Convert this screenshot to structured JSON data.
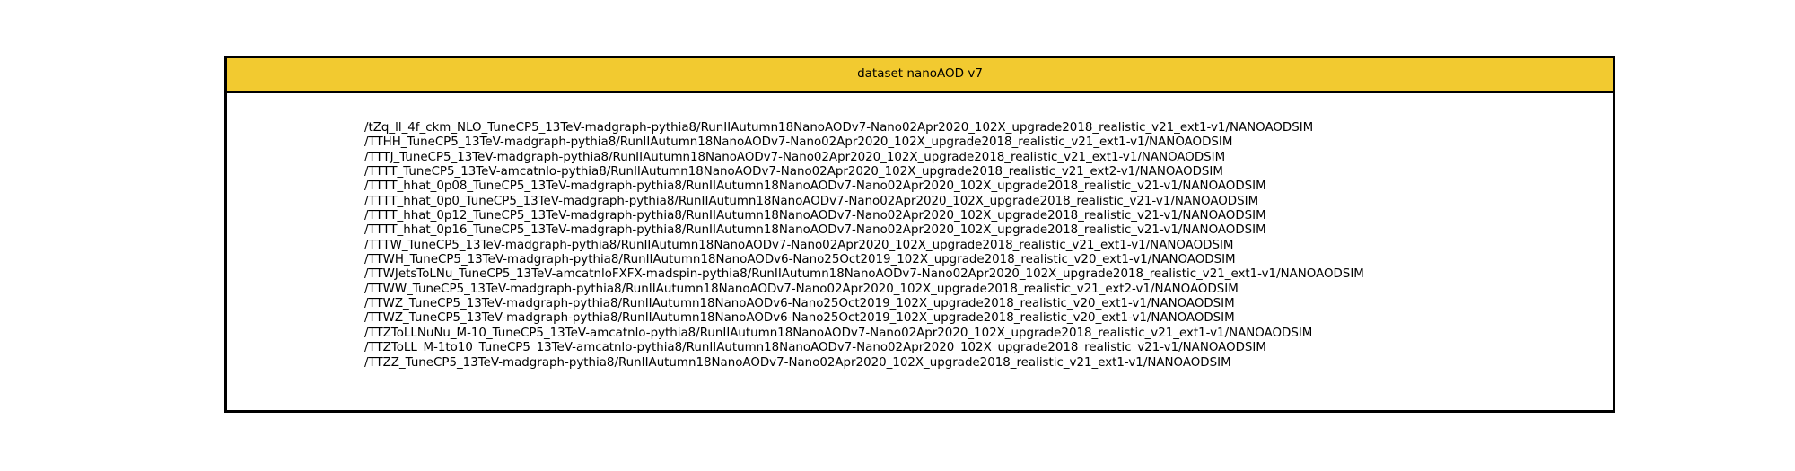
{
  "table": {
    "header": "dataset nanoAOD v7",
    "datasets": [
      "/tZq_ll_4f_ckm_NLO_TuneCP5_13TeV-madgraph-pythia8/RunIIAutumn18NanoAODv7-Nano02Apr2020_102X_upgrade2018_realistic_v21_ext1-v1/NANOAODSIM",
      "/TTHH_TuneCP5_13TeV-madgraph-pythia8/RunIIAutumn18NanoAODv7-Nano02Apr2020_102X_upgrade2018_realistic_v21_ext1-v1/NANOAODSIM",
      "/TTTJ_TuneCP5_13TeV-madgraph-pythia8/RunIIAutumn18NanoAODv7-Nano02Apr2020_102X_upgrade2018_realistic_v21_ext1-v1/NANOAODSIM",
      "/TTTT_TuneCP5_13TeV-amcatnlo-pythia8/RunIIAutumn18NanoAODv7-Nano02Apr2020_102X_upgrade2018_realistic_v21_ext2-v1/NANOAODSIM",
      "/TTTT_hhat_0p08_TuneCP5_13TeV-madgraph-pythia8/RunIIAutumn18NanoAODv7-Nano02Apr2020_102X_upgrade2018_realistic_v21-v1/NANOAODSIM",
      "/TTTT_hhat_0p0_TuneCP5_13TeV-madgraph-pythia8/RunIIAutumn18NanoAODv7-Nano02Apr2020_102X_upgrade2018_realistic_v21-v1/NANOAODSIM",
      "/TTTT_hhat_0p12_TuneCP5_13TeV-madgraph-pythia8/RunIIAutumn18NanoAODv7-Nano02Apr2020_102X_upgrade2018_realistic_v21-v1/NANOAODSIM",
      "/TTTT_hhat_0p16_TuneCP5_13TeV-madgraph-pythia8/RunIIAutumn18NanoAODv7-Nano02Apr2020_102X_upgrade2018_realistic_v21-v1/NANOAODSIM",
      "/TTTW_TuneCP5_13TeV-madgraph-pythia8/RunIIAutumn18NanoAODv7-Nano02Apr2020_102X_upgrade2018_realistic_v21_ext1-v1/NANOAODSIM",
      "/TTWH_TuneCP5_13TeV-madgraph-pythia8/RunIIAutumn18NanoAODv6-Nano25Oct2019_102X_upgrade2018_realistic_v20_ext1-v1/NANOAODSIM",
      "/TTWJetsToLNu_TuneCP5_13TeV-amcatnloFXFX-madspin-pythia8/RunIIAutumn18NanoAODv7-Nano02Apr2020_102X_upgrade2018_realistic_v21_ext1-v1/NANOAODSIM",
      "/TTWW_TuneCP5_13TeV-madgraph-pythia8/RunIIAutumn18NanoAODv7-Nano02Apr2020_102X_upgrade2018_realistic_v21_ext2-v1/NANOAODSIM",
      "/TTWZ_TuneCP5_13TeV-madgraph-pythia8/RunIIAutumn18NanoAODv6-Nano25Oct2019_102X_upgrade2018_realistic_v20_ext1-v1/NANOAODSIM",
      "/TTWZ_TuneCP5_13TeV-madgraph-pythia8/RunIIAutumn18NanoAODv6-Nano25Oct2019_102X_upgrade2018_realistic_v20_ext1-v1/NANOAODSIM",
      "/TTZToLLNuNu_M-10_TuneCP5_13TeV-amcatnlo-pythia8/RunIIAutumn18NanoAODv7-Nano02Apr2020_102X_upgrade2018_realistic_v21_ext1-v1/NANOAODSIM",
      "/TTZToLL_M-1to10_TuneCP5_13TeV-amcatnlo-pythia8/RunIIAutumn18NanoAODv7-Nano02Apr2020_102X_upgrade2018_realistic_v21-v1/NANOAODSIM",
      "/TTZZ_TuneCP5_13TeV-madgraph-pythia8/RunIIAutumn18NanoAODv7-Nano02Apr2020_102X_upgrade2018_realistic_v21_ext1-v1/NANOAODSIM"
    ]
  },
  "colors": {
    "header_background": "#f2ca30",
    "border": "#000000",
    "text": "#000000"
  }
}
